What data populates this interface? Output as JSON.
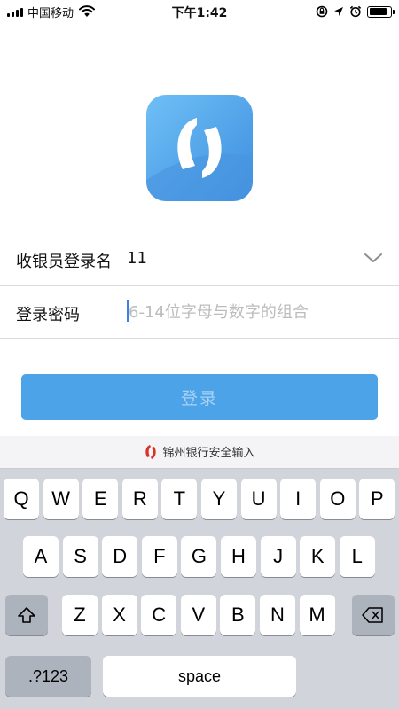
{
  "status_bar": {
    "carrier": "中国移动",
    "time": "下午1:42",
    "battery_level": 0.9
  },
  "form": {
    "username_label": "收银员登录名",
    "username_value": "11",
    "password_label": "登录密码",
    "password_placeholder": "6-14位字母与数字的组合"
  },
  "login_button": {
    "label": "登录"
  },
  "colors": {
    "accent": "#4da3e8",
    "button_text": "#a9d2f5",
    "brand_red": "#d9322b",
    "keyboard_bg": "#d1d4da"
  },
  "keyboard": {
    "title": "锦州银行安全输入",
    "row1": [
      "Q",
      "W",
      "E",
      "R",
      "T",
      "Y",
      "U",
      "I",
      "O",
      "P"
    ],
    "row2": [
      "A",
      "S",
      "D",
      "F",
      "G",
      "H",
      "J",
      "K",
      "L"
    ],
    "row3": [
      "Z",
      "X",
      "C",
      "V",
      "B",
      "N",
      "M"
    ],
    "numbers_label": ".?123",
    "space_label": "space"
  }
}
